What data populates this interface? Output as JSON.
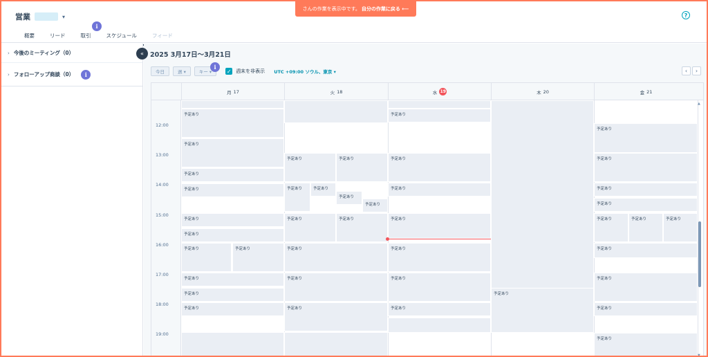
{
  "banner": {
    "text": "さんの作業を表示中です。",
    "link": "自分の作業に戻る ⟵"
  },
  "header": {
    "title": "営業",
    "help_glyph": "?",
    "tabs": [
      {
        "label": "概要",
        "state": "normal"
      },
      {
        "label": "リード",
        "state": "normal"
      },
      {
        "label": "取引",
        "state": "normal"
      },
      {
        "label": "スケジュール",
        "state": "active"
      },
      {
        "label": "フィード",
        "state": "disabled"
      }
    ]
  },
  "badge_glyph": "i",
  "sidebar": {
    "collapse_glyph": "«",
    "items": [
      {
        "label": "今後のミーティング（0）"
      },
      {
        "label": "フォローアップ商談（0）"
      }
    ]
  },
  "main": {
    "week_title": "2025 3月17日～3月21日",
    "toolbar": {
      "today": "今日",
      "week": "週 ▾",
      "key": "キー ▾",
      "hide_weekends_label": "週末を非表示",
      "hide_weekends_checked": true,
      "timezone": "UTC +09:00 ソウル、東京 ▾"
    },
    "nav": {
      "prev": "‹",
      "next": "›"
    },
    "days": [
      {
        "label": "月",
        "date": "17",
        "today": false
      },
      {
        "label": "火",
        "date": "18",
        "today": false
      },
      {
        "label": "水",
        "date": "19",
        "today": true
      },
      {
        "label": "木",
        "date": "20",
        "today": false
      },
      {
        "label": "金",
        "date": "21",
        "today": false
      }
    ],
    "times": [
      "12:00",
      "13:00",
      "14:00",
      "15:00",
      "16:00",
      "17:00",
      "18:00",
      "19:00"
    ],
    "event_label": "予定あり"
  }
}
